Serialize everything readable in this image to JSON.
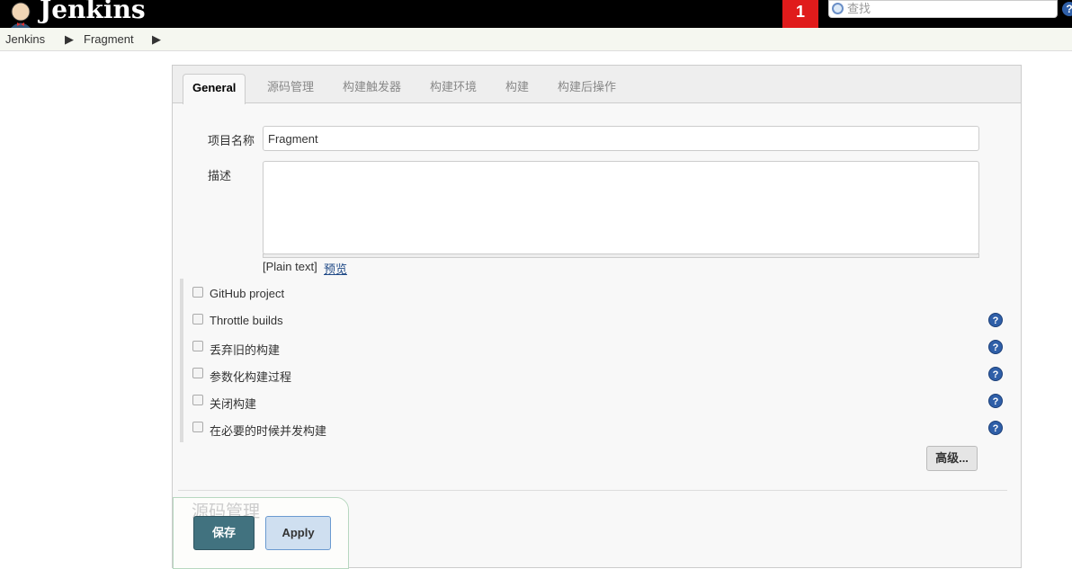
{
  "header": {
    "brand": "Jenkins",
    "notification_count": "1",
    "search_placeholder": "查找",
    "help": "?"
  },
  "breadcrumb": [
    "Jenkins",
    "Fragment"
  ],
  "tabs": [
    "General",
    "源码管理",
    "构建触发器",
    "构建环境",
    "构建",
    "构建后操作"
  ],
  "form": {
    "name_label": "项目名称",
    "name_value": "Fragment",
    "desc_label": "描述",
    "desc_value": "",
    "plain_text": "[Plain text]",
    "preview": "预览",
    "options": [
      {
        "label": "GitHub project",
        "checked": false,
        "help": false
      },
      {
        "label": "Throttle builds",
        "checked": false,
        "help": true
      },
      {
        "label": "丢弃旧的构建",
        "checked": false,
        "help": true
      },
      {
        "label": "参数化构建过程",
        "checked": false,
        "help": true
      },
      {
        "label": "关闭构建",
        "checked": false,
        "help": true
      },
      {
        "label": "在必要的时候并发构建",
        "checked": false,
        "help": true
      }
    ],
    "advanced": "高级..."
  },
  "section_heading": "源码管理",
  "buttons": {
    "save": "保存",
    "apply": "Apply"
  },
  "colors": {
    "save": "#41727f",
    "apply": "#cfdff0",
    "badge": "#e01b1b"
  }
}
